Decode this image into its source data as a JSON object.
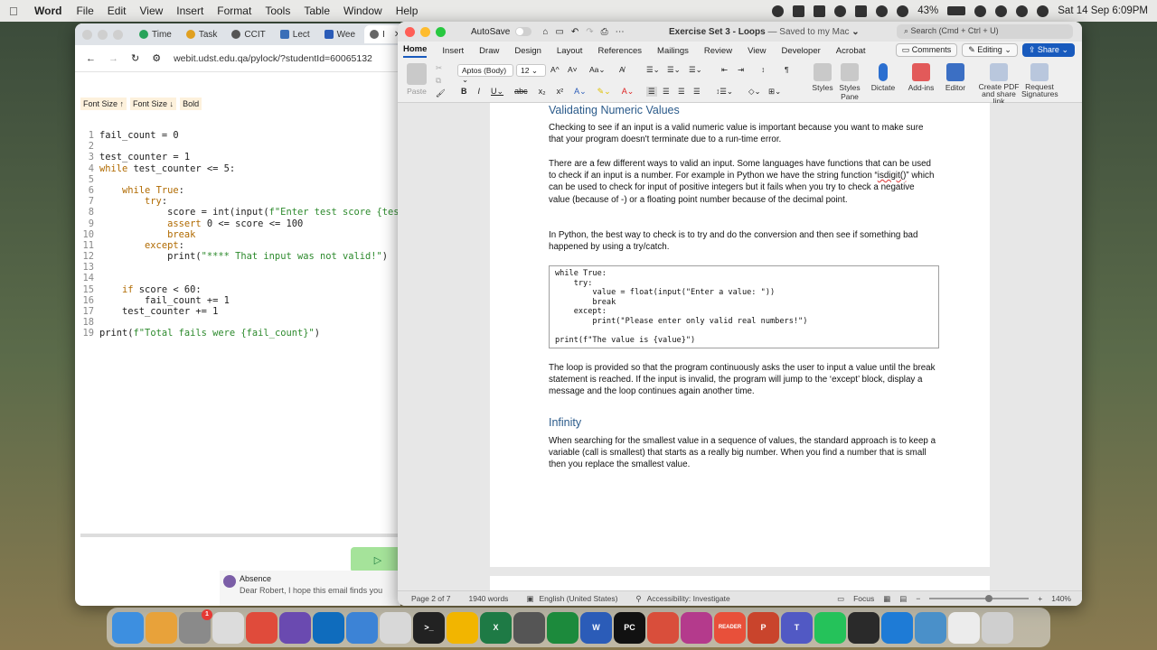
{
  "menubar": {
    "app_name": "Word",
    "menus": [
      "File",
      "Edit",
      "View",
      "Insert",
      "Format",
      "Tools",
      "Table",
      "Window",
      "Help"
    ],
    "battery": "43%",
    "datetime": "Sat 14 Sep  6:09PM"
  },
  "browser": {
    "tabs": [
      {
        "label": "Time",
        "icon": "timer-icon"
      },
      {
        "label": "Task",
        "icon": "checkmark-icon"
      },
      {
        "label": "CCIT",
        "icon": "globe-icon"
      },
      {
        "label": "Lect",
        "icon": "document-icon"
      },
      {
        "label": "Wee",
        "icon": "word-doc-icon"
      },
      {
        "label": "I",
        "icon": "globe-icon"
      }
    ],
    "url": "webit.udst.edu.qa/pylock/?studentId=60065132",
    "toolbar": {
      "font_up": "Font Size ↑",
      "font_down": "Font Size ↓",
      "bold": "Bold"
    },
    "code_lines": [
      {
        "n": "1",
        "segments": [
          {
            "t": "fail_count = 0",
            "c": "fn"
          }
        ]
      },
      {
        "n": "2",
        "segments": []
      },
      {
        "n": "3",
        "segments": [
          {
            "t": "test_counter = 1",
            "c": "fn"
          }
        ]
      },
      {
        "n": "4",
        "segments": [
          {
            "t": "while",
            "c": "kw"
          },
          {
            "t": " test_counter <= 5:",
            "c": "fn"
          }
        ]
      },
      {
        "n": "5",
        "segments": []
      },
      {
        "n": "6",
        "segments": [
          {
            "t": "    ",
            "c": "fn"
          },
          {
            "t": "while True",
            "c": "kw"
          },
          {
            "t": ":",
            "c": "fn"
          }
        ]
      },
      {
        "n": "7",
        "segments": [
          {
            "t": "        ",
            "c": "fn"
          },
          {
            "t": "try",
            "c": "kw"
          },
          {
            "t": ":",
            "c": "fn"
          }
        ]
      },
      {
        "n": "8",
        "segments": [
          {
            "t": "            score = int(input(",
            "c": "fn"
          },
          {
            "t": "f\"Enter test score {tes",
            "c": "str"
          }
        ]
      },
      {
        "n": "9",
        "segments": [
          {
            "t": "            ",
            "c": "fn"
          },
          {
            "t": "assert",
            "c": "kw"
          },
          {
            "t": " 0 <= score <= 100",
            "c": "fn"
          }
        ]
      },
      {
        "n": "10",
        "segments": [
          {
            "t": "            ",
            "c": "fn"
          },
          {
            "t": "break",
            "c": "kw"
          }
        ]
      },
      {
        "n": "11",
        "segments": [
          {
            "t": "        ",
            "c": "fn"
          },
          {
            "t": "except",
            "c": "kw"
          },
          {
            "t": ":",
            "c": "fn"
          }
        ]
      },
      {
        "n": "12",
        "segments": [
          {
            "t": "            print(",
            "c": "fn"
          },
          {
            "t": "\"**** That input was not valid!\"",
            "c": "str"
          },
          {
            "t": ")",
            "c": "fn"
          }
        ]
      },
      {
        "n": "13",
        "segments": []
      },
      {
        "n": "14",
        "segments": []
      },
      {
        "n": "15",
        "segments": [
          {
            "t": "    ",
            "c": "fn"
          },
          {
            "t": "if",
            "c": "kw"
          },
          {
            "t": " score < 60:",
            "c": "fn"
          }
        ]
      },
      {
        "n": "16",
        "segments": [
          {
            "t": "        fail_count += 1",
            "c": "fn"
          }
        ]
      },
      {
        "n": "17",
        "segments": [
          {
            "t": "    test_counter += 1",
            "c": "fn"
          }
        ]
      },
      {
        "n": "18",
        "segments": []
      },
      {
        "n": "19",
        "segments": [
          {
            "t": "print(",
            "c": "fn"
          },
          {
            "t": "f\"Total fails were {fail_count}\"",
            "c": "str"
          },
          {
            "t": ")",
            "c": "fn"
          }
        ]
      }
    ],
    "mail": {
      "subject": "Absence",
      "preview": "Dear Robert, I hope this email finds you"
    }
  },
  "word": {
    "autosave_label": "AutoSave",
    "doc_title": "Exercise Set 3 - Loops",
    "saved_status": "— Saved to my Mac",
    "search_placeholder": "Search (Cmd + Ctrl + U)",
    "ribbon_tabs": [
      "Home",
      "Insert",
      "Draw",
      "Design",
      "Layout",
      "References",
      "Mailings",
      "Review",
      "View",
      "Developer",
      "Acrobat"
    ],
    "buttons": {
      "comments": "Comments",
      "editing": "Editing",
      "share": "Share"
    },
    "ribbon": {
      "paste": "Paste",
      "font_name": "Aptos (Body)",
      "font_size": "12",
      "styles": "Styles",
      "styles_pane": "Styles Pane",
      "dictate": "Dictate",
      "addins": "Add-ins",
      "editor": "Editor",
      "create_pdf": "Create PDF and share link",
      "request_sig": "Request Signatures"
    },
    "doc": {
      "heading1": "Validating Numeric Values",
      "p1": "Checking to see if an input is a valid numeric value is important because you want to make sure that your program doesn't terminate due to a run-time error.",
      "p2_a": "There are a few different ways to valid an input. Some languages have functions that can be used to check if an input is a number. For example in Python we have the string function “",
      "p2_b": "isdigit()",
      "p2_c": "” which can be used to check for input of positive integers but it fails when you try to check a negative value (because of -) or a floating point number because of the decimal point.",
      "p3": "In Python, the best way to check is to try and do the conversion and then see if something bad happened by using a try/catch.",
      "code": "while True:\n    try:\n        value = float(input(\"Enter a value: \"))\n        break\n    except:\n        print(\"Please enter only valid real numbers!\")\n\nprint(f\"The value is {value}\")",
      "p4": "The loop is provided so that the program continuously asks the user to input a value until the break statement is reached.  If the input is invalid, the program will jump to the ‘except’ block, display a message and the loop continues again another time.",
      "heading2": "Infinity",
      "p5": "When searching for the smallest value in a sequence of values, the standard approach is to keep a variable (call is smallest) that starts as a really big number. When you find a number that is small then you replace the smallest value."
    },
    "status": {
      "page": "Page 2 of 7",
      "words": "1940 words",
      "language": "English (United States)",
      "accessibility": "Accessibility: Investigate",
      "focus": "Focus",
      "zoom": "140%"
    }
  },
  "dock": [
    {
      "name": "finder-icon",
      "color": "#3d8fe0",
      "label": ""
    },
    {
      "name": "launchpad-icon",
      "color": "#e8a23a",
      "label": ""
    },
    {
      "name": "system-settings-icon",
      "color": "#8a8a8a",
      "label": "",
      "badge": "1"
    },
    {
      "name": "textedit-icon",
      "color": "#dcdcdc",
      "label": ""
    },
    {
      "name": "chrome-icon",
      "color": "#e04b3b",
      "label": ""
    },
    {
      "name": "github-icon",
      "color": "#6a4ab0",
      "label": ""
    },
    {
      "name": "outlook-icon",
      "color": "#0f6cbd",
      "label": ""
    },
    {
      "name": "vpn-icon",
      "color": "#3c83d6",
      "label": ""
    },
    {
      "name": "tableplus-icon",
      "color": "#d8d8d8",
      "label": ""
    },
    {
      "name": "terminal-icon",
      "color": "#222222",
      "label": ">_"
    },
    {
      "name": "chrome-icon",
      "color": "#f2b500",
      "label": ""
    },
    {
      "name": "excel-icon",
      "color": "#1e7a45",
      "label": "X"
    },
    {
      "name": "calculator-icon",
      "color": "#555555",
      "label": ""
    },
    {
      "name": "mongodb-icon",
      "color": "#1c8a3c",
      "label": ""
    },
    {
      "name": "word-icon",
      "color": "#2b5cb8",
      "label": "W"
    },
    {
      "name": "pycharm-icon",
      "color": "#111111",
      "label": "PC"
    },
    {
      "name": "pencil-icon",
      "color": "#d94e3b",
      "label": ""
    },
    {
      "name": "color-picker-icon",
      "color": "#b43a8c",
      "label": ""
    },
    {
      "name": "reader-icon",
      "color": "#e8503a",
      "label": "READER"
    },
    {
      "name": "powerpoint-icon",
      "color": "#c9442c",
      "label": "P"
    },
    {
      "name": "teams-icon",
      "color": "#5159c4",
      "label": "T"
    },
    {
      "name": "whatsapp-icon",
      "color": "#25c25a",
      "label": ""
    },
    {
      "name": "stocks-icon",
      "color": "#2a2a2a",
      "label": ""
    },
    {
      "name": "vscode-icon",
      "color": "#1e7bd6",
      "label": ""
    },
    {
      "name": "quicktime-icon",
      "color": "#4a90c9",
      "label": ""
    },
    {
      "name": "document-icon",
      "color": "#ececec",
      "label": ""
    },
    {
      "name": "trash-icon",
      "color": "#cfcfcf",
      "label": ""
    }
  ]
}
